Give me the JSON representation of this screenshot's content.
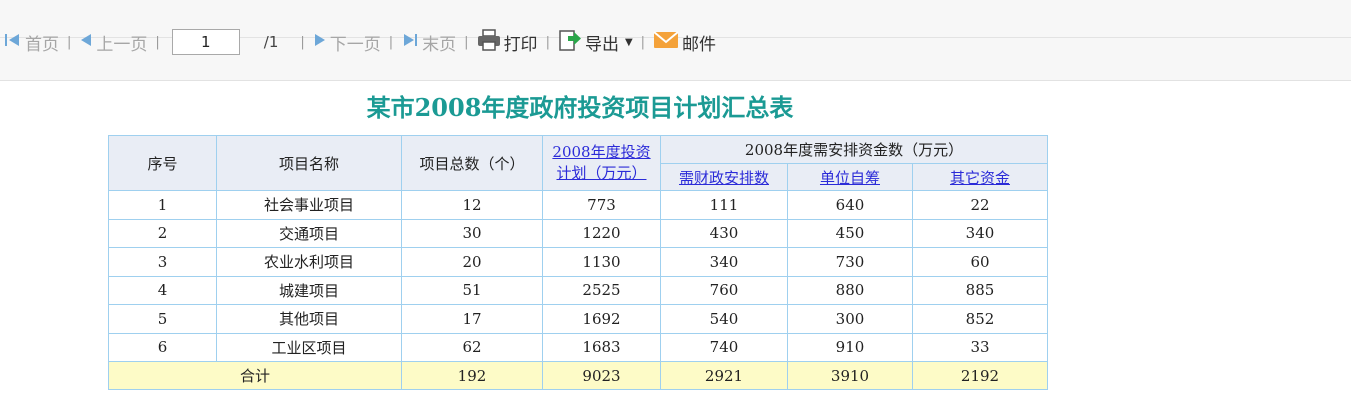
{
  "toolbar": {
    "first_label": "首页",
    "prev_label": "上一页",
    "page_value": "1",
    "total_pages": "/1",
    "next_label": "下一页",
    "last_label": "末页",
    "print_label": "打印",
    "export_label": "导出",
    "mail_label": "邮件"
  },
  "report": {
    "title": "某市2008年度政府投资项目计划汇总表",
    "headers": {
      "seq": "序号",
      "name": "项目名称",
      "count": "项目总数（个）",
      "plan_line1": "2008年度投资",
      "plan_line2": "计划（万元）",
      "funds_group": "2008年度需安排资金数（万元）",
      "fiscal": "需财政安排数",
      "self": "单位自筹",
      "other": "其它资金"
    },
    "rows": [
      {
        "seq": "1",
        "name": "社会事业项目",
        "count": "12",
        "plan": "773",
        "fiscal": "111",
        "self": "640",
        "other": "22"
      },
      {
        "seq": "2",
        "name": "交通项目",
        "count": "30",
        "plan": "1220",
        "fiscal": "430",
        "self": "450",
        "other": "340"
      },
      {
        "seq": "3",
        "name": "农业水利项目",
        "count": "20",
        "plan": "1130",
        "fiscal": "340",
        "self": "730",
        "other": "60"
      },
      {
        "seq": "4",
        "name": "城建项目",
        "count": "51",
        "plan": "2525",
        "fiscal": "760",
        "self": "880",
        "other": "885"
      },
      {
        "seq": "5",
        "name": "其他项目",
        "count": "17",
        "plan": "1692",
        "fiscal": "540",
        "self": "300",
        "other": "852"
      },
      {
        "seq": "6",
        "name": "工业区项目",
        "count": "62",
        "plan": "1683",
        "fiscal": "740",
        "self": "910",
        "other": "33"
      }
    ],
    "total": {
      "label": "合计",
      "count": "192",
      "plan": "9023",
      "fiscal": "2921",
      "self": "3910",
      "other": "2192"
    }
  },
  "colors": {
    "title": "#1b9a94",
    "header_bg": "#e9edf5",
    "total_bg": "#fdfbc7",
    "border": "#9fd0ef",
    "link": "#2b2bd8"
  }
}
